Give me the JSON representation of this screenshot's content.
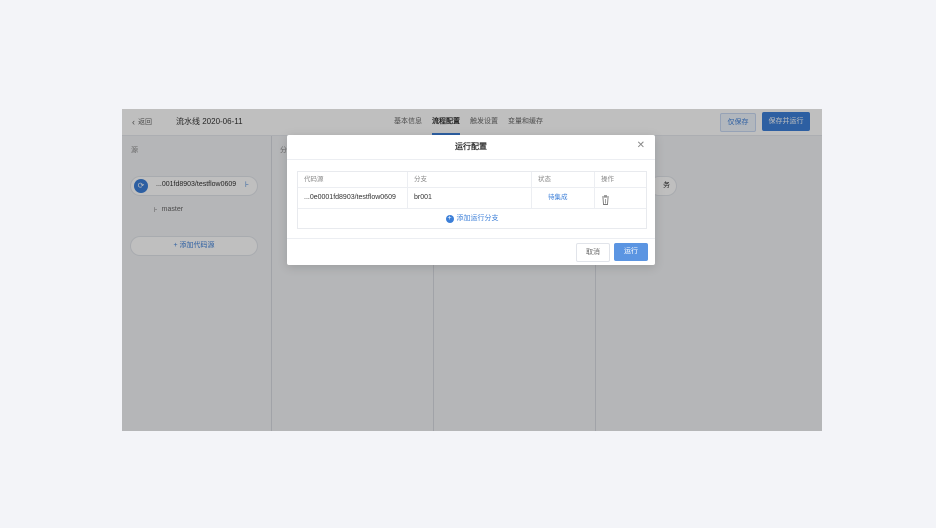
{
  "header": {
    "back_label": "返回",
    "pipeline_title": "流水线 2020-06-11",
    "tabs": [
      {
        "label": "基本信息"
      },
      {
        "label": "流程配置"
      },
      {
        "label": "触发设置"
      },
      {
        "label": "变量和缓存"
      }
    ],
    "save_label": "仅保存",
    "save_run_label": "保存并运行"
  },
  "stages": {
    "source_label": "源",
    "second_label": "分",
    "task_label": "务"
  },
  "source": {
    "repo_name": "...001fd8903/testflow0609",
    "branch": "master",
    "add_repo_label": "添加代码源"
  },
  "modal": {
    "title": "运行配置",
    "columns": [
      "代码源",
      "分支",
      "状态",
      "操作"
    ],
    "rows": [
      {
        "repo": "...0e0001fd8903/testflow0609",
        "branch": "br001",
        "status": "待集成"
      }
    ],
    "add_branch_label": "添加运行分支",
    "cancel_label": "取消",
    "run_label": "运行"
  },
  "colors": {
    "accent": "#3c7fd8",
    "overlay": "rgba(0,0,0,0.25)"
  }
}
